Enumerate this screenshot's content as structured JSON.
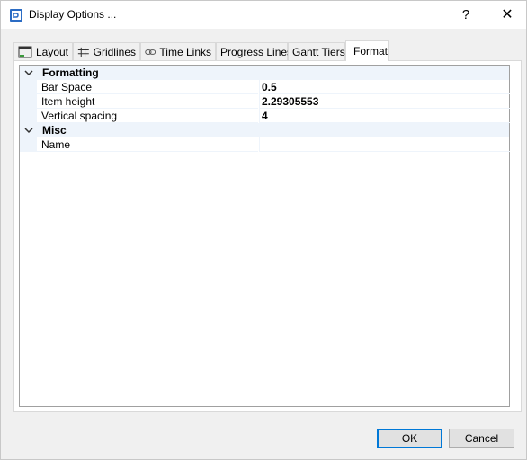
{
  "window": {
    "title": "Display Options ...",
    "help_label": "?",
    "close_label": "✕"
  },
  "tabs": [
    {
      "label": "Layout",
      "icon": "layout-icon"
    },
    {
      "label": "Gridlines",
      "icon": "gridlines-icon"
    },
    {
      "label": "Time Links",
      "icon": "link-icon"
    },
    {
      "label": "Progress Lines"
    },
    {
      "label": "Gantt Tiers"
    },
    {
      "label": "Format",
      "active": true
    }
  ],
  "property_grid": {
    "categories": [
      {
        "label": "Formatting",
        "properties": [
          {
            "name": "Bar Space",
            "value": "0.5"
          },
          {
            "name": "Item height",
            "value": "2.29305553"
          },
          {
            "name": "Vertical spacing",
            "value": "4"
          }
        ]
      },
      {
        "label": "Misc",
        "properties": [
          {
            "name": "Name",
            "value": ""
          }
        ]
      }
    ]
  },
  "buttons": {
    "ok": "OK",
    "cancel": "Cancel"
  },
  "colors": {
    "category_band": "#eef4fb",
    "accent": "#0078d7"
  }
}
